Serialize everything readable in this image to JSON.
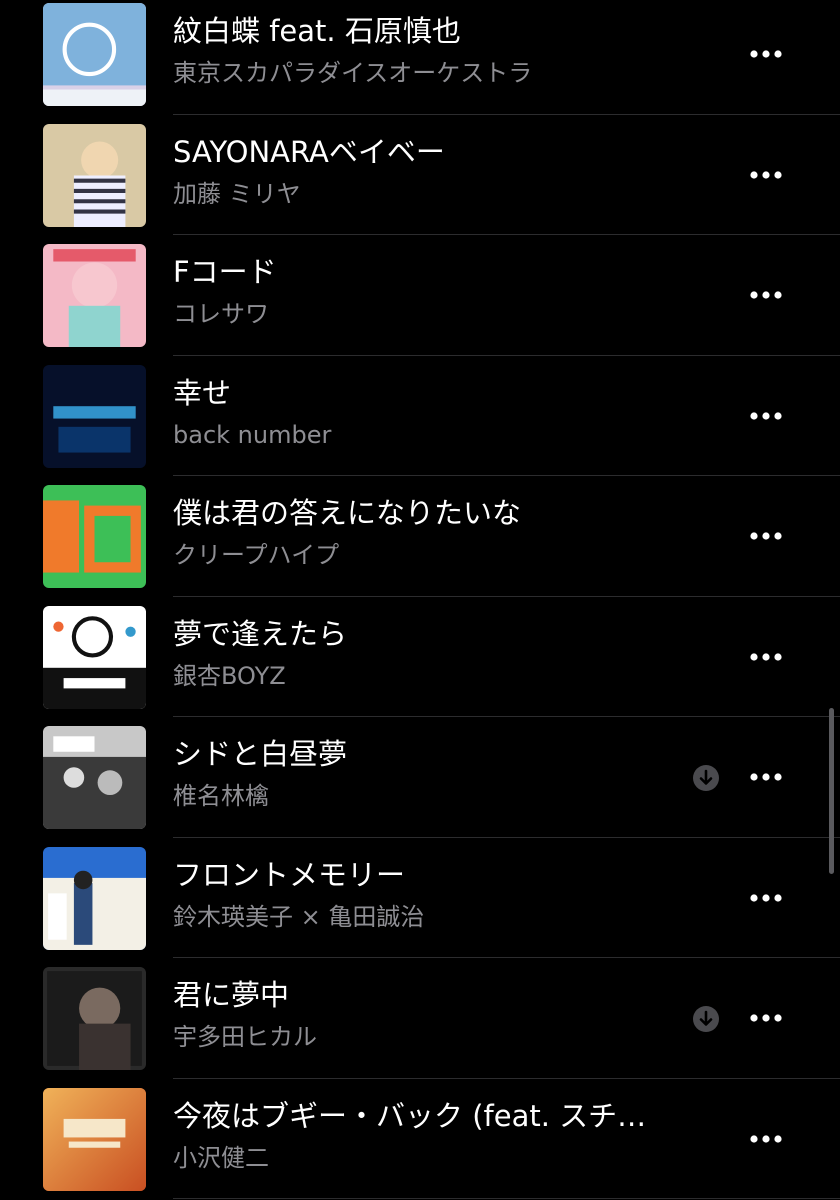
{
  "songs": [
    {
      "title": "紋白蝶 feat. 石原慎也",
      "artist": "東京スカパラダイスオーケストラ",
      "downloaded": false,
      "art_colors": [
        "#7fb2dc",
        "#d9d1e8"
      ]
    },
    {
      "title": "SAYONARAベイベー",
      "artist": "加藤 ミリヤ",
      "downloaded": false,
      "art_colors": [
        "#d9c9a5",
        "#8a7a62"
      ]
    },
    {
      "title": "Fコード",
      "artist": "コレサワ",
      "downloaded": false,
      "art_colors": [
        "#f4b9c6",
        "#8fd4cf"
      ]
    },
    {
      "title": "幸せ",
      "artist": "back number",
      "downloaded": false,
      "art_colors": [
        "#06102a",
        "#3aa9e6"
      ]
    },
    {
      "title": "僕は君の答えになりたいな",
      "artist": "クリープハイプ",
      "downloaded": false,
      "art_colors": [
        "#3dbf57",
        "#f07a2b"
      ]
    },
    {
      "title": "夢で逢えたら",
      "artist": "銀杏BOYZ",
      "downloaded": false,
      "art_colors": [
        "#ffffff",
        "#111111"
      ]
    },
    {
      "title": "シドと白昼夢",
      "artist": "椎名林檎",
      "downloaded": true,
      "art_colors": [
        "#c8c8c8",
        "#3a3a3a"
      ]
    },
    {
      "title": "フロントメモリー",
      "artist": "鈴木瑛美子 × 亀田誠治",
      "downloaded": false,
      "art_colors": [
        "#2a6dd0",
        "#f3f0e6"
      ]
    },
    {
      "title": "君に夢中",
      "artist": "宇多田ヒカル",
      "downloaded": true,
      "art_colors": [
        "#efe3e1",
        "#2a2a2a"
      ]
    },
    {
      "title": "今夜はブギー・バック (feat. スチ…",
      "artist": "小沢健二",
      "downloaded": false,
      "art_colors": [
        "#c94f22",
        "#f0b259"
      ]
    }
  ],
  "colors": {
    "background": "#000000",
    "title_text": "#ffffff",
    "artist_text": "#8e8e93",
    "divider": "#2c2c2e",
    "icon_gray": "#5a5a5e"
  },
  "icons": {
    "more": "ellipsis-icon",
    "download": "downloaded-icon"
  }
}
